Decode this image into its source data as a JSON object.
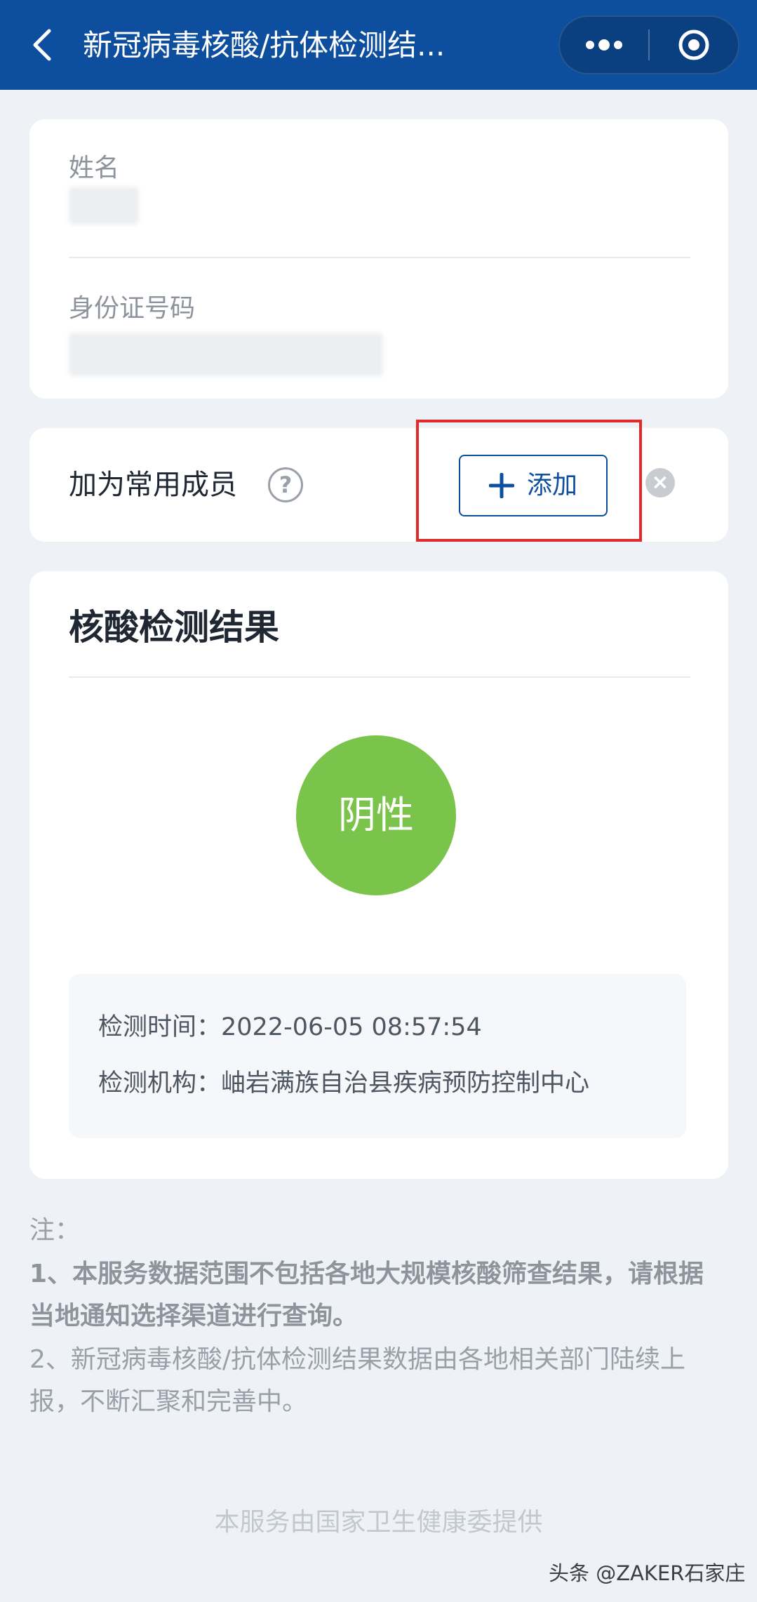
{
  "header": {
    "title": "新冠病毒核酸/抗体检测结...",
    "back_icon": "chevron-left-icon",
    "more_icon": "more-dots-icon",
    "close_icon": "target-circle-icon",
    "bg_color": "#0d4f9e"
  },
  "info": {
    "name_label": "姓名",
    "id_label": "身份证号码"
  },
  "member": {
    "label": "加为常用成员",
    "help_glyph": "?",
    "add_label": "添加",
    "close_glyph": "×"
  },
  "result": {
    "title": "核酸检测结果",
    "status": "阴性",
    "status_color": "#7bc44c",
    "time_line": "检测时间：2022-06-05 08:57:54",
    "org_line": "检测机构：岫岩满族自治县疾病预防控制中心"
  },
  "notes": {
    "label": "注：",
    "line1": "1、本服务数据范围不包括各地大规模核酸筛查结果，请根据当地通知选择渠道进行查询。",
    "line2": "2、新冠病毒核酸/抗体检测结果数据由各地相关部门陆续上报，不断汇聚和完善中。"
  },
  "footer": "本服务由国家卫生健康委提供",
  "watermark": "头条 @ZAKER石家庄"
}
